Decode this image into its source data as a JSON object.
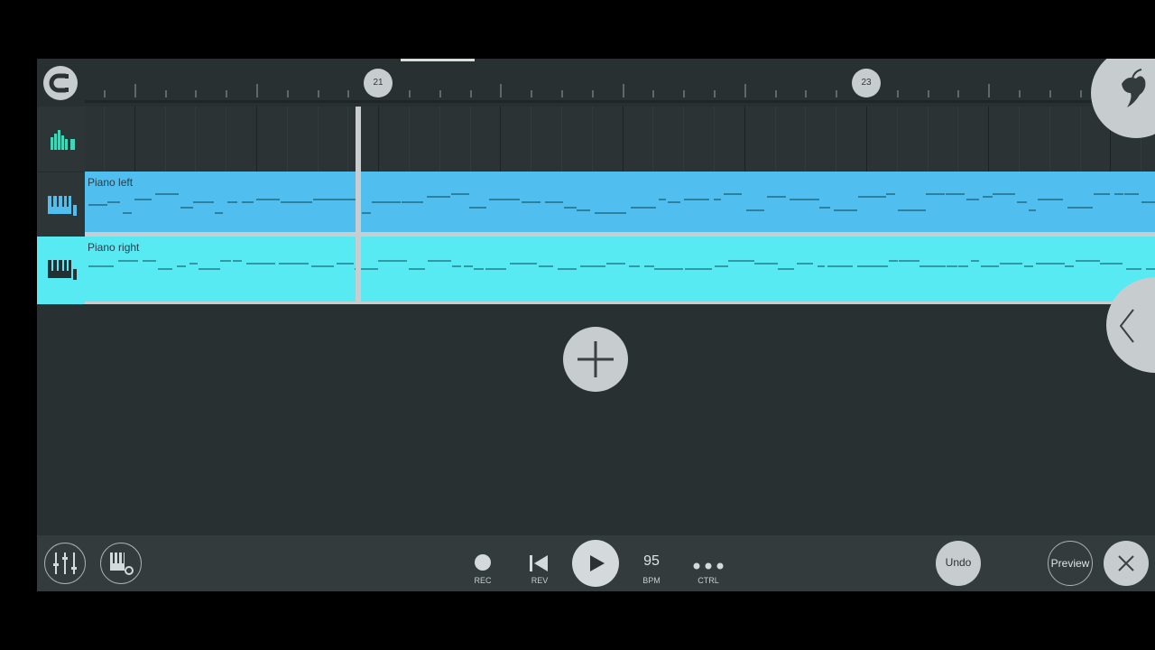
{
  "ruler": {
    "markers": [
      "21",
      "23"
    ]
  },
  "tracks": [
    {
      "label": "Piano left",
      "color": "#50bff0",
      "icon": "piano-icon"
    },
    {
      "label": "Piano right",
      "color": "#57eaf3",
      "icon": "piano-icon"
    }
  ],
  "toolbar": {
    "rec_label": "REC",
    "rev_label": "REV",
    "bpm_value": "95",
    "bpm_label": "BPM",
    "ctrl_label": "CTRL",
    "undo_label": "Undo",
    "preview_label": "Preview"
  },
  "icons": [
    "magnet-icon",
    "fl-studio-logo-icon",
    "chevron-left-icon",
    "plus-icon",
    "mixer-icon",
    "piano-settings-icon",
    "record-icon",
    "rewind-icon",
    "play-icon",
    "more-icon",
    "close-icon"
  ]
}
